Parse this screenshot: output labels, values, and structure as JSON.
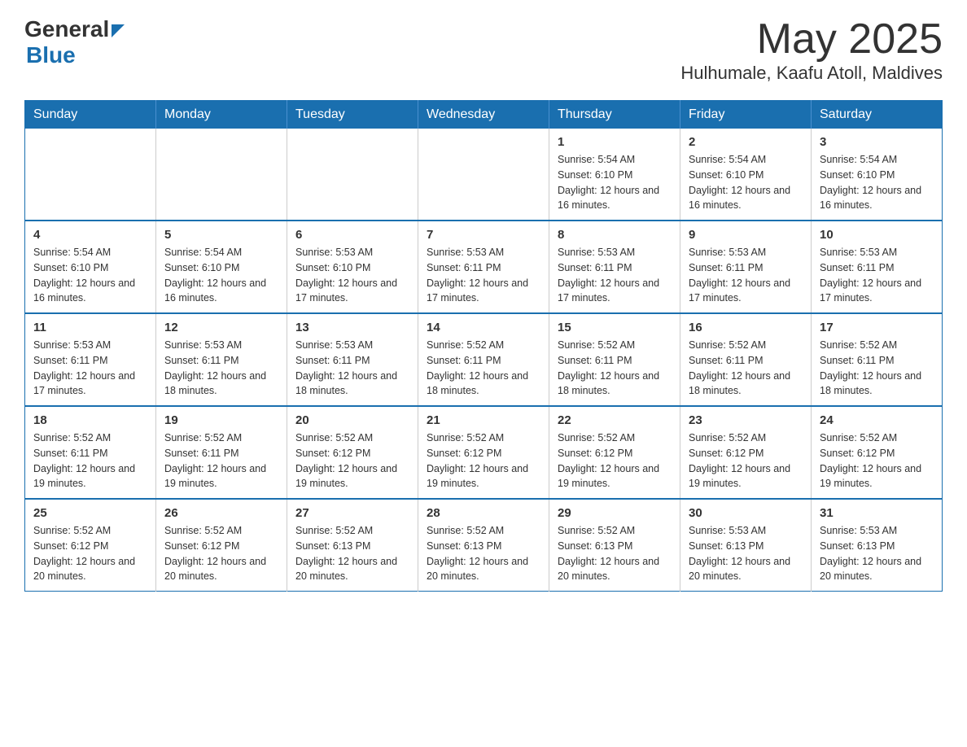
{
  "header": {
    "logo_general": "General",
    "logo_blue": "Blue",
    "month": "May 2025",
    "location": "Hulhumale, Kaafu Atoll, Maldives"
  },
  "weekdays": [
    "Sunday",
    "Monday",
    "Tuesday",
    "Wednesday",
    "Thursday",
    "Friday",
    "Saturday"
  ],
  "weeks": [
    [
      {
        "day": "",
        "info": ""
      },
      {
        "day": "",
        "info": ""
      },
      {
        "day": "",
        "info": ""
      },
      {
        "day": "",
        "info": ""
      },
      {
        "day": "1",
        "info": "Sunrise: 5:54 AM\nSunset: 6:10 PM\nDaylight: 12 hours and 16 minutes."
      },
      {
        "day": "2",
        "info": "Sunrise: 5:54 AM\nSunset: 6:10 PM\nDaylight: 12 hours and 16 minutes."
      },
      {
        "day": "3",
        "info": "Sunrise: 5:54 AM\nSunset: 6:10 PM\nDaylight: 12 hours and 16 minutes."
      }
    ],
    [
      {
        "day": "4",
        "info": "Sunrise: 5:54 AM\nSunset: 6:10 PM\nDaylight: 12 hours and 16 minutes."
      },
      {
        "day": "5",
        "info": "Sunrise: 5:54 AM\nSunset: 6:10 PM\nDaylight: 12 hours and 16 minutes."
      },
      {
        "day": "6",
        "info": "Sunrise: 5:53 AM\nSunset: 6:10 PM\nDaylight: 12 hours and 17 minutes."
      },
      {
        "day": "7",
        "info": "Sunrise: 5:53 AM\nSunset: 6:11 PM\nDaylight: 12 hours and 17 minutes."
      },
      {
        "day": "8",
        "info": "Sunrise: 5:53 AM\nSunset: 6:11 PM\nDaylight: 12 hours and 17 minutes."
      },
      {
        "day": "9",
        "info": "Sunrise: 5:53 AM\nSunset: 6:11 PM\nDaylight: 12 hours and 17 minutes."
      },
      {
        "day": "10",
        "info": "Sunrise: 5:53 AM\nSunset: 6:11 PM\nDaylight: 12 hours and 17 minutes."
      }
    ],
    [
      {
        "day": "11",
        "info": "Sunrise: 5:53 AM\nSunset: 6:11 PM\nDaylight: 12 hours and 17 minutes."
      },
      {
        "day": "12",
        "info": "Sunrise: 5:53 AM\nSunset: 6:11 PM\nDaylight: 12 hours and 18 minutes."
      },
      {
        "day": "13",
        "info": "Sunrise: 5:53 AM\nSunset: 6:11 PM\nDaylight: 12 hours and 18 minutes."
      },
      {
        "day": "14",
        "info": "Sunrise: 5:52 AM\nSunset: 6:11 PM\nDaylight: 12 hours and 18 minutes."
      },
      {
        "day": "15",
        "info": "Sunrise: 5:52 AM\nSunset: 6:11 PM\nDaylight: 12 hours and 18 minutes."
      },
      {
        "day": "16",
        "info": "Sunrise: 5:52 AM\nSunset: 6:11 PM\nDaylight: 12 hours and 18 minutes."
      },
      {
        "day": "17",
        "info": "Sunrise: 5:52 AM\nSunset: 6:11 PM\nDaylight: 12 hours and 18 minutes."
      }
    ],
    [
      {
        "day": "18",
        "info": "Sunrise: 5:52 AM\nSunset: 6:11 PM\nDaylight: 12 hours and 19 minutes."
      },
      {
        "day": "19",
        "info": "Sunrise: 5:52 AM\nSunset: 6:11 PM\nDaylight: 12 hours and 19 minutes."
      },
      {
        "day": "20",
        "info": "Sunrise: 5:52 AM\nSunset: 6:12 PM\nDaylight: 12 hours and 19 minutes."
      },
      {
        "day": "21",
        "info": "Sunrise: 5:52 AM\nSunset: 6:12 PM\nDaylight: 12 hours and 19 minutes."
      },
      {
        "day": "22",
        "info": "Sunrise: 5:52 AM\nSunset: 6:12 PM\nDaylight: 12 hours and 19 minutes."
      },
      {
        "day": "23",
        "info": "Sunrise: 5:52 AM\nSunset: 6:12 PM\nDaylight: 12 hours and 19 minutes."
      },
      {
        "day": "24",
        "info": "Sunrise: 5:52 AM\nSunset: 6:12 PM\nDaylight: 12 hours and 19 minutes."
      }
    ],
    [
      {
        "day": "25",
        "info": "Sunrise: 5:52 AM\nSunset: 6:12 PM\nDaylight: 12 hours and 20 minutes."
      },
      {
        "day": "26",
        "info": "Sunrise: 5:52 AM\nSunset: 6:12 PM\nDaylight: 12 hours and 20 minutes."
      },
      {
        "day": "27",
        "info": "Sunrise: 5:52 AM\nSunset: 6:13 PM\nDaylight: 12 hours and 20 minutes."
      },
      {
        "day": "28",
        "info": "Sunrise: 5:52 AM\nSunset: 6:13 PM\nDaylight: 12 hours and 20 minutes."
      },
      {
        "day": "29",
        "info": "Sunrise: 5:52 AM\nSunset: 6:13 PM\nDaylight: 12 hours and 20 minutes."
      },
      {
        "day": "30",
        "info": "Sunrise: 5:53 AM\nSunset: 6:13 PM\nDaylight: 12 hours and 20 minutes."
      },
      {
        "day": "31",
        "info": "Sunrise: 5:53 AM\nSunset: 6:13 PM\nDaylight: 12 hours and 20 minutes."
      }
    ]
  ]
}
